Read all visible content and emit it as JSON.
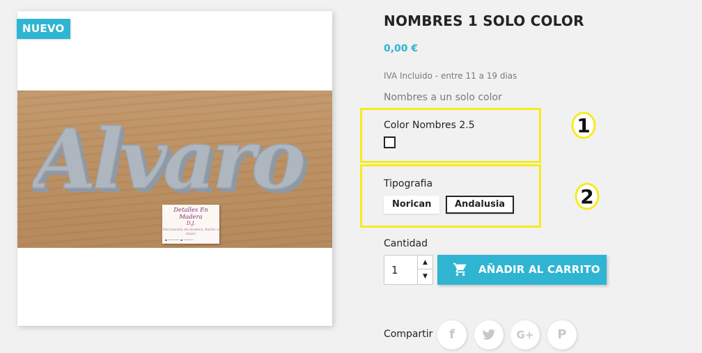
{
  "badge": "NUEVO",
  "product": {
    "title": "NOMBRES 1 SOLO COLOR",
    "price": "0,00 €",
    "tax_info": "IVA Incluido  - entre 11 a 19 dias",
    "description": "Nombres a un solo color"
  },
  "image": {
    "word": "Alvaro",
    "card_title": "Detalles En Madera",
    "card_sub": "D.J.",
    "card_tag": "Decoración en madera, hecho a mano"
  },
  "variants": {
    "color_label": "Color Nombres 2.5",
    "typo_label": "Tipografia",
    "typo_options": [
      "Norican",
      "Andalusia"
    ],
    "typo_selected": "Andalusia"
  },
  "annotations": [
    "1",
    "2"
  ],
  "quantity": {
    "label": "Cantidad",
    "value": "1"
  },
  "add_to_cart": "AÑADIR AL CARRITO",
  "share": {
    "label": "Compartir"
  },
  "colors": {
    "accent": "#2fb5d2",
    "highlight": "#f5ec1d",
    "text": "#232323",
    "muted": "#7a7a7a"
  }
}
